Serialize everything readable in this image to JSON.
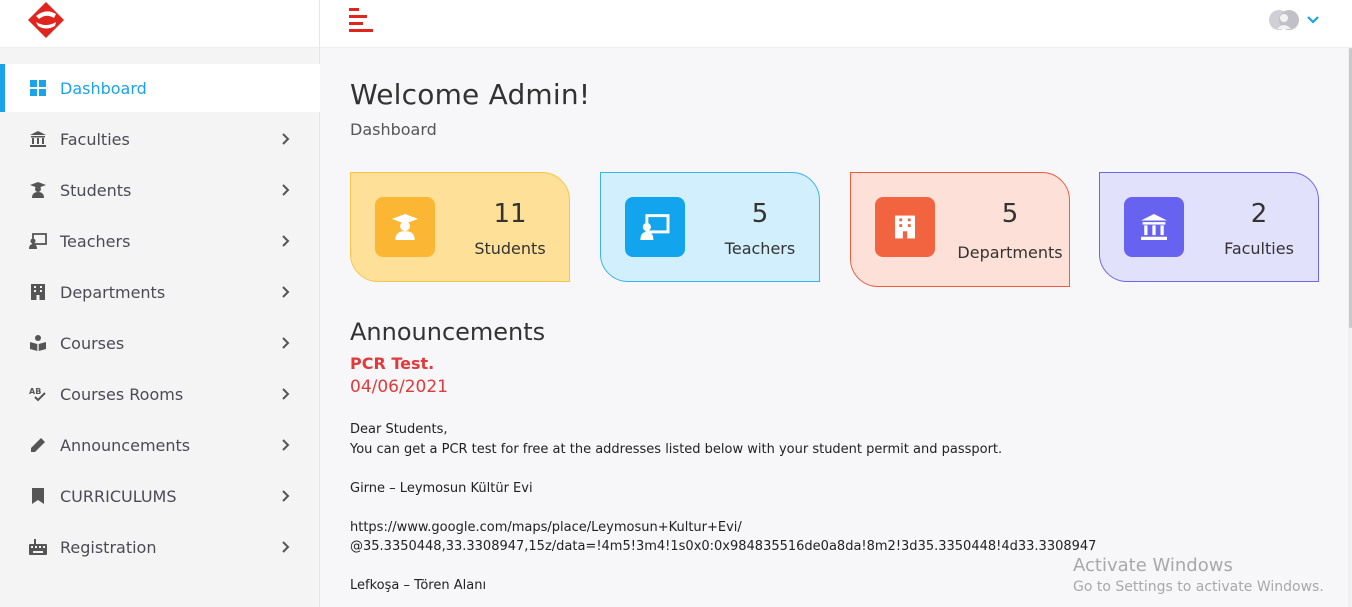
{
  "brand": {
    "logo": "brand-logo-icon",
    "accent": "#e0251f"
  },
  "sidebar": {
    "items": [
      {
        "label": "Dashboard",
        "icon": "grid-icon",
        "active": true
      },
      {
        "label": "Faculties",
        "icon": "university-icon"
      },
      {
        "label": "Students",
        "icon": "graduate-icon"
      },
      {
        "label": "Teachers",
        "icon": "teacher-icon"
      },
      {
        "label": "Departments",
        "icon": "building-icon"
      },
      {
        "label": "Courses",
        "icon": "book-reader-icon"
      },
      {
        "label": "Courses Rooms",
        "icon": "spellcheck-icon"
      },
      {
        "label": "Announcements",
        "icon": "pencil-icon"
      },
      {
        "label": "CURRICULUMS",
        "icon": "bookmark-icon"
      },
      {
        "label": "Registration",
        "icon": "keyboard-icon"
      }
    ]
  },
  "topbar": {
    "menu_icon": "menu-toggle-icon",
    "user_icon": "avatar-icon",
    "dropdown_icon": "chevron-down-icon"
  },
  "main": {
    "welcome": "Welcome Admin!",
    "breadcrumb": "Dashboard",
    "cards": [
      {
        "count": "11",
        "label": "Students",
        "icon": "graduate-icon",
        "color": "#fbb733"
      },
      {
        "count": "5",
        "label": "Teachers",
        "icon": "teacher-icon",
        "color": "#12a4ec"
      },
      {
        "count": "5",
        "label": "Departments",
        "icon": "building-icon",
        "color": "#f2643f"
      },
      {
        "count": "2",
        "label": "Faculties",
        "icon": "university-icon",
        "color": "#6762ef"
      }
    ],
    "announcements": {
      "title": "Announcements",
      "item_title": "PCR Test.",
      "item_date": "04/06/2021",
      "body": "Dear Students,\nYou can get a PCR test for free at the addresses listed below with your student permit and passport.\n\nGirne – Leymosun Kültür Evi\n\nhttps://www.google.com/maps/place/Leymosun+Kultur+Evi/\n@35.3350448,33.3308947,15z/data=!4m5!3m4!1s0x0:0x984835516de0a8da!8m2!3d35.3350448!4d33.3308947\n\nLefkoşa – Tören Alanı"
    }
  },
  "watermark": {
    "line1": "Activate Windows",
    "line2": "Go to Settings to activate Windows."
  }
}
